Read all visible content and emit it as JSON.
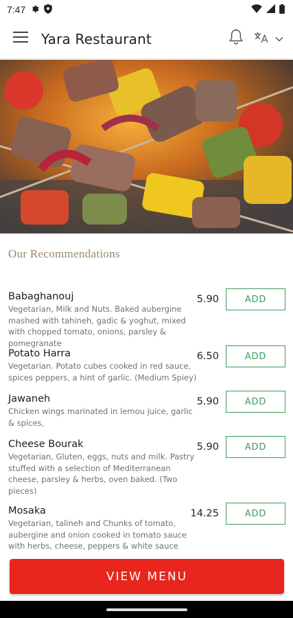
{
  "status_bar": {
    "time": "7:47"
  },
  "header": {
    "title": "Yara Restaurant"
  },
  "section": {
    "title": "Our Recommendations"
  },
  "menu_items": [
    {
      "name": "Babaghanouj",
      "description": "Vegetarian, Milk and Nuts. Baked aubergine mashed with tahineh, gadic & yoghut, mixed with chopped tomato, onions, parsley & pomegranate",
      "price": "5.90",
      "add_label": "ADD"
    },
    {
      "name": "Potato Harra",
      "description": "Vegetarian. Potato cubes cooked in red sauce, spices peppers, a hint of garlic. (Medium Spiey)",
      "price": "6.50",
      "add_label": "ADD"
    },
    {
      "name": "Jawaneh",
      "description": "Chicken wings marinated in lemou juice, garlic & spices,",
      "price": "5.90",
      "add_label": "ADD"
    },
    {
      "name": "Cheese Bourak",
      "description": "Vegetarian, Gluten, eggs, nuts and milk. Pastry stuffed with a selection of Mediterranean cheese, parsley & herbs, oven baked. (Two pieces)",
      "price": "5.90",
      "add_label": "ADD"
    },
    {
      "name": "Mosaka",
      "description": "Vegetarian, talineh and Chunks of tomato, aubergine and onion cooked in tomato sauce with herbs, cheese, peppers & white sauce",
      "price": "14.25",
      "add_label": "ADD"
    }
  ],
  "footer": {
    "view_menu_label": "VIEW MENU"
  },
  "icons": {
    "menu": "hamburger-menu-icon",
    "notifications": "bell-icon",
    "language": "language-icon",
    "dropdown": "chevron-down-icon"
  },
  "colors": {
    "accent_red": "#e8261e",
    "add_green": "#3f9a58",
    "section_title": "#9a8a6a"
  }
}
